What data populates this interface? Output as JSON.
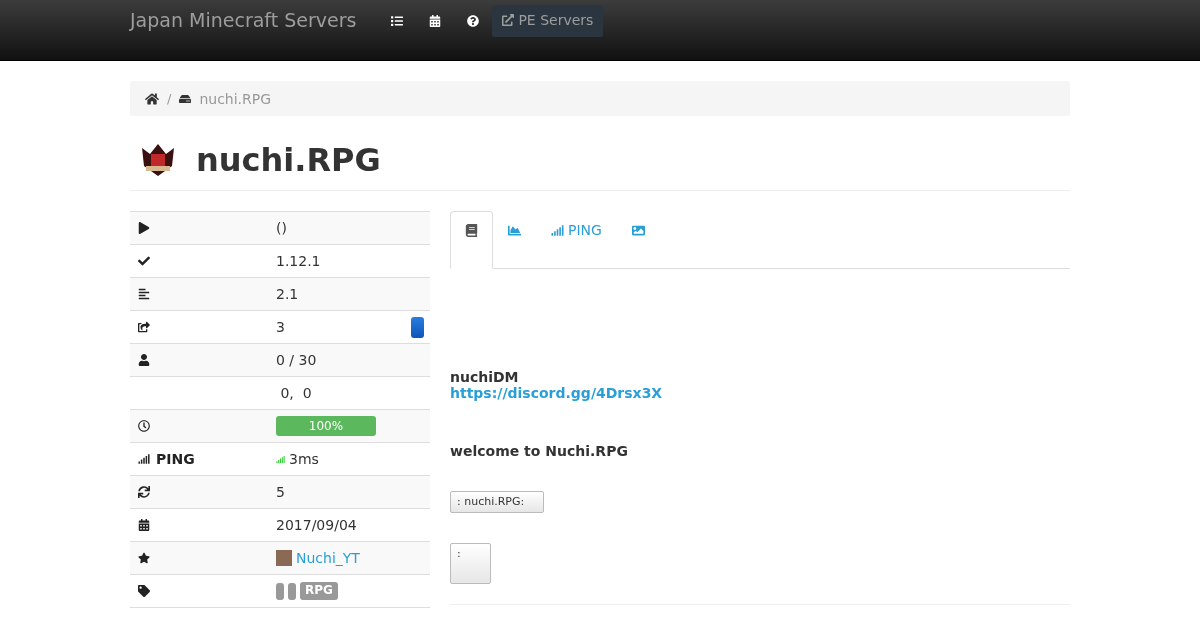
{
  "navbar": {
    "brand": "Japan Minecraft Servers",
    "external_link": "PE Servers"
  },
  "breadcrumb": {
    "separator": "/",
    "current": "nuchi.RPG"
  },
  "title": "nuchi.RPG",
  "info_rows": [
    {
      "kind": "text",
      "value": "()"
    },
    {
      "kind": "text",
      "value": "1.12.1"
    },
    {
      "kind": "text",
      "value": "2.1"
    },
    {
      "kind": "badge",
      "value": "3"
    },
    {
      "kind": "text",
      "value": "0 / 30"
    },
    {
      "kind": "text",
      "value": " 0,  0"
    },
    {
      "kind": "progress",
      "value": "100%",
      "level": 1
    },
    {
      "kind": "ping",
      "label": "PING",
      "value": "3ms"
    },
    {
      "kind": "text",
      "value": "5"
    },
    {
      "kind": "text",
      "value": "2017/09/04"
    },
    {
      "kind": "user",
      "value": "Nuchi_YT"
    },
    {
      "kind": "tags",
      "tags": [
        {
          "kind": "empty"
        },
        {
          "kind": "empty"
        },
        {
          "kind": "text",
          "label": "RPG"
        }
      ]
    }
  ],
  "tabs": [
    {
      "selected": true
    },
    {
      "selected": false
    },
    {
      "label": "PING",
      "selected": false
    },
    {
      "selected": false
    }
  ],
  "description": {
    "name": "nuchiDM",
    "link": "https://discord.gg/4Drsx3X",
    "welcome": "welcome to Nuchi.RPG",
    "button_1": ": nuchi.RPG:",
    "button_2": ":"
  }
}
